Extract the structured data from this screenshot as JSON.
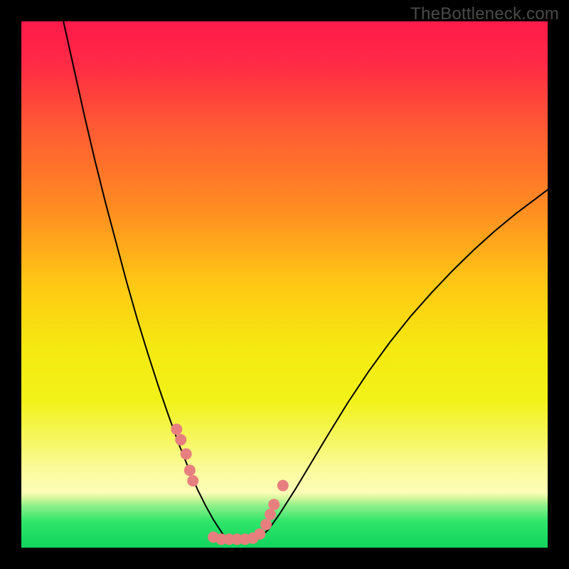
{
  "watermark": "TheBottleneck.com",
  "chart_data": {
    "type": "line",
    "title": "",
    "xlabel": "",
    "ylabel": "",
    "xlim": [
      0,
      100
    ],
    "ylim": [
      0,
      100
    ],
    "gradient_stops": [
      {
        "offset": 0.0,
        "color": "#ff1a4a"
      },
      {
        "offset": 0.08,
        "color": "#ff2a46"
      },
      {
        "offset": 0.2,
        "color": "#ff5a33"
      },
      {
        "offset": 0.35,
        "color": "#ff8a22"
      },
      {
        "offset": 0.5,
        "color": "#ffc814"
      },
      {
        "offset": 0.62,
        "color": "#f4e910"
      },
      {
        "offset": 0.72,
        "color": "#f2f219"
      },
      {
        "offset": 0.8,
        "color": "#f6f766"
      },
      {
        "offset": 0.85,
        "color": "#fbfb9a"
      },
      {
        "offset": 0.895,
        "color": "#fdfdb8"
      },
      {
        "offset": 0.905,
        "color": "#d9f79f"
      },
      {
        "offset": 0.92,
        "color": "#8ef08a"
      },
      {
        "offset": 0.95,
        "color": "#30e56a"
      },
      {
        "offset": 1.0,
        "color": "#10d45c"
      }
    ],
    "series": [
      {
        "name": "left-curve",
        "stroke": "#000000",
        "stroke_width": 2,
        "x": [
          8,
          10,
          12,
          14,
          16,
          18,
          20,
          22,
          24,
          26,
          28,
          30,
          32,
          33.5,
          35,
          36.5,
          38,
          39
        ],
        "y": [
          100,
          91,
          82,
          73.5,
          65.5,
          58,
          50.5,
          43.5,
          37,
          30.8,
          25,
          19.5,
          14.5,
          11,
          8,
          5.3,
          3,
          1.6
        ]
      },
      {
        "name": "right-curve",
        "stroke": "#000000",
        "stroke_width": 2,
        "x": [
          45,
          47,
          49,
          52,
          55,
          58,
          62,
          66,
          70,
          74,
          78,
          82,
          86,
          90,
          94,
          98,
          100
        ],
        "y": [
          1.6,
          3.5,
          6.3,
          11,
          16,
          21,
          27.5,
          33.5,
          39,
          44,
          48.5,
          52.7,
          56.6,
          60.2,
          63.5,
          66.5,
          68
        ]
      }
    ],
    "markers": {
      "color": "#e77f7f",
      "radius": 8,
      "points": [
        {
          "x": 29.5,
          "y": 22.5
        },
        {
          "x": 30.3,
          "y": 20.5
        },
        {
          "x": 31.3,
          "y": 17.8
        },
        {
          "x": 32.0,
          "y": 14.7
        },
        {
          "x": 32.6,
          "y": 12.7
        },
        {
          "x": 36.5,
          "y": 2.0
        },
        {
          "x": 38.0,
          "y": 1.6
        },
        {
          "x": 39.5,
          "y": 1.6
        },
        {
          "x": 41.0,
          "y": 1.6
        },
        {
          "x": 42.5,
          "y": 1.6
        },
        {
          "x": 44.0,
          "y": 1.8
        },
        {
          "x": 45.3,
          "y": 2.6
        },
        {
          "x": 46.5,
          "y": 4.4
        },
        {
          "x": 47.3,
          "y": 6.3
        },
        {
          "x": 48.0,
          "y": 8.2
        },
        {
          "x": 49.7,
          "y": 11.8
        }
      ]
    },
    "green_band": {
      "y_range_pct": [
        0.905,
        1.0
      ]
    }
  }
}
